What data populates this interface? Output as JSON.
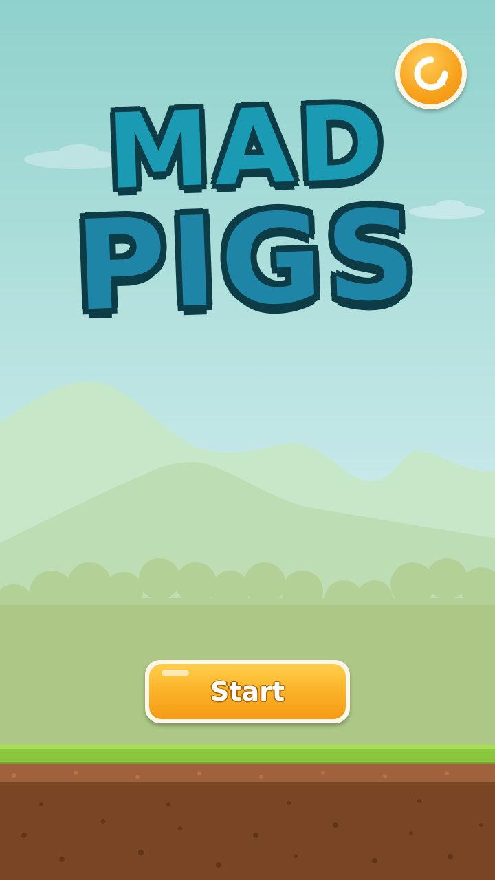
{
  "game": {
    "title_line1": "MAD",
    "title_line2": "PIGS"
  },
  "controls": {
    "start_label": "Start",
    "refresh_icon": "refresh-icon"
  },
  "colors": {
    "sky_top": "#8fd1cc",
    "title_blue": "#1b9bb3",
    "title_outline": "#0d3c47",
    "button_orange": "#f7a21c",
    "grass": "#8ac73d",
    "dirt": "#7a4525"
  }
}
